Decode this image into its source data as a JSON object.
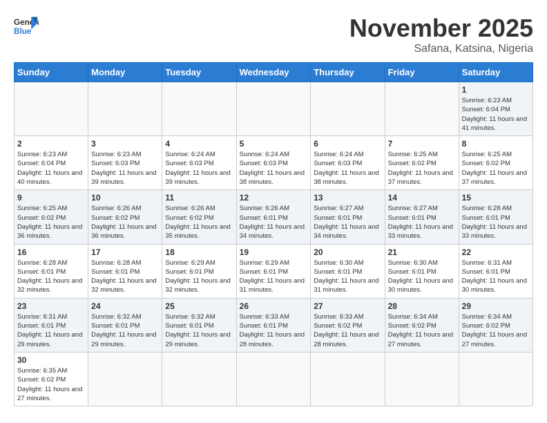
{
  "logo": {
    "text_general": "General",
    "text_blue": "Blue"
  },
  "header": {
    "month": "November 2025",
    "location": "Safana, Katsina, Nigeria"
  },
  "weekdays": [
    "Sunday",
    "Monday",
    "Tuesday",
    "Wednesday",
    "Thursday",
    "Friday",
    "Saturday"
  ],
  "weeks": [
    [
      {
        "day": "",
        "info": ""
      },
      {
        "day": "",
        "info": ""
      },
      {
        "day": "",
        "info": ""
      },
      {
        "day": "",
        "info": ""
      },
      {
        "day": "",
        "info": ""
      },
      {
        "day": "",
        "info": ""
      },
      {
        "day": "1",
        "info": "Sunrise: 6:23 AM\nSunset: 6:04 PM\nDaylight: 11 hours\nand 41 minutes."
      }
    ],
    [
      {
        "day": "2",
        "info": "Sunrise: 6:23 AM\nSunset: 6:04 PM\nDaylight: 11 hours\nand 40 minutes."
      },
      {
        "day": "3",
        "info": "Sunrise: 6:23 AM\nSunset: 6:03 PM\nDaylight: 11 hours\nand 39 minutes."
      },
      {
        "day": "4",
        "info": "Sunrise: 6:24 AM\nSunset: 6:03 PM\nDaylight: 11 hours\nand 39 minutes."
      },
      {
        "day": "5",
        "info": "Sunrise: 6:24 AM\nSunset: 6:03 PM\nDaylight: 11 hours\nand 38 minutes."
      },
      {
        "day": "6",
        "info": "Sunrise: 6:24 AM\nSunset: 6:03 PM\nDaylight: 11 hours\nand 38 minutes."
      },
      {
        "day": "7",
        "info": "Sunrise: 6:25 AM\nSunset: 6:02 PM\nDaylight: 11 hours\nand 37 minutes."
      },
      {
        "day": "8",
        "info": "Sunrise: 6:25 AM\nSunset: 6:02 PM\nDaylight: 11 hours\nand 37 minutes."
      }
    ],
    [
      {
        "day": "9",
        "info": "Sunrise: 6:25 AM\nSunset: 6:02 PM\nDaylight: 11 hours\nand 36 minutes."
      },
      {
        "day": "10",
        "info": "Sunrise: 6:26 AM\nSunset: 6:02 PM\nDaylight: 11 hours\nand 36 minutes."
      },
      {
        "day": "11",
        "info": "Sunrise: 6:26 AM\nSunset: 6:02 PM\nDaylight: 11 hours\nand 35 minutes."
      },
      {
        "day": "12",
        "info": "Sunrise: 6:26 AM\nSunset: 6:01 PM\nDaylight: 11 hours\nand 34 minutes."
      },
      {
        "day": "13",
        "info": "Sunrise: 6:27 AM\nSunset: 6:01 PM\nDaylight: 11 hours\nand 34 minutes."
      },
      {
        "day": "14",
        "info": "Sunrise: 6:27 AM\nSunset: 6:01 PM\nDaylight: 11 hours\nand 33 minutes."
      },
      {
        "day": "15",
        "info": "Sunrise: 6:28 AM\nSunset: 6:01 PM\nDaylight: 11 hours\nand 33 minutes."
      }
    ],
    [
      {
        "day": "16",
        "info": "Sunrise: 6:28 AM\nSunset: 6:01 PM\nDaylight: 11 hours\nand 32 minutes."
      },
      {
        "day": "17",
        "info": "Sunrise: 6:28 AM\nSunset: 6:01 PM\nDaylight: 11 hours\nand 32 minutes."
      },
      {
        "day": "18",
        "info": "Sunrise: 6:29 AM\nSunset: 6:01 PM\nDaylight: 11 hours\nand 32 minutes."
      },
      {
        "day": "19",
        "info": "Sunrise: 6:29 AM\nSunset: 6:01 PM\nDaylight: 11 hours\nand 31 minutes."
      },
      {
        "day": "20",
        "info": "Sunrise: 6:30 AM\nSunset: 6:01 PM\nDaylight: 11 hours\nand 31 minutes."
      },
      {
        "day": "21",
        "info": "Sunrise: 6:30 AM\nSunset: 6:01 PM\nDaylight: 11 hours\nand 30 minutes."
      },
      {
        "day": "22",
        "info": "Sunrise: 6:31 AM\nSunset: 6:01 PM\nDaylight: 11 hours\nand 30 minutes."
      }
    ],
    [
      {
        "day": "23",
        "info": "Sunrise: 6:31 AM\nSunset: 6:01 PM\nDaylight: 11 hours\nand 29 minutes."
      },
      {
        "day": "24",
        "info": "Sunrise: 6:32 AM\nSunset: 6:01 PM\nDaylight: 11 hours\nand 29 minutes."
      },
      {
        "day": "25",
        "info": "Sunrise: 6:32 AM\nSunset: 6:01 PM\nDaylight: 11 hours\nand 29 minutes."
      },
      {
        "day": "26",
        "info": "Sunrise: 6:33 AM\nSunset: 6:01 PM\nDaylight: 11 hours\nand 28 minutes."
      },
      {
        "day": "27",
        "info": "Sunrise: 6:33 AM\nSunset: 6:02 PM\nDaylight: 11 hours\nand 28 minutes."
      },
      {
        "day": "28",
        "info": "Sunrise: 6:34 AM\nSunset: 6:02 PM\nDaylight: 11 hours\nand 27 minutes."
      },
      {
        "day": "29",
        "info": "Sunrise: 6:34 AM\nSunset: 6:02 PM\nDaylight: 11 hours\nand 27 minutes."
      }
    ],
    [
      {
        "day": "30",
        "info": "Sunrise: 6:35 AM\nSunset: 6:02 PM\nDaylight: 11 hours\nand 27 minutes."
      },
      {
        "day": "",
        "info": ""
      },
      {
        "day": "",
        "info": ""
      },
      {
        "day": "",
        "info": ""
      },
      {
        "day": "",
        "info": ""
      },
      {
        "day": "",
        "info": ""
      },
      {
        "day": "",
        "info": ""
      }
    ]
  ]
}
